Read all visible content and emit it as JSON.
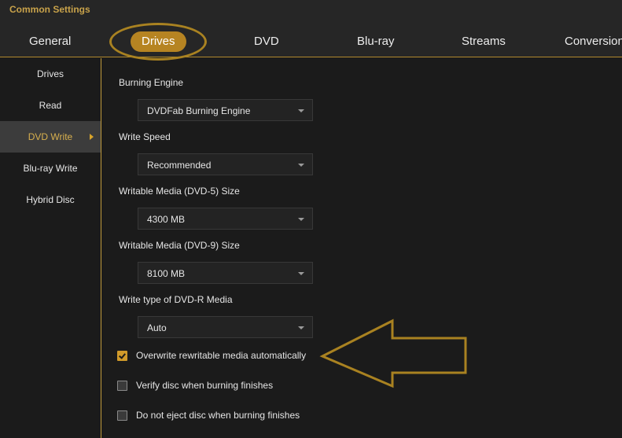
{
  "window": {
    "title": "Common Settings"
  },
  "tabs": [
    {
      "label": "General"
    },
    {
      "label": "Drives",
      "active": true
    },
    {
      "label": "DVD"
    },
    {
      "label": "Blu-ray"
    },
    {
      "label": "Streams"
    },
    {
      "label": "Conversion"
    }
  ],
  "sidebar": {
    "items": [
      {
        "label": "Drives"
      },
      {
        "label": "Read"
      },
      {
        "label": "DVD Write",
        "active": true
      },
      {
        "label": "Blu-ray Write"
      },
      {
        "label": "Hybrid Disc"
      }
    ]
  },
  "settings": {
    "burning_engine": {
      "label": "Burning Engine",
      "value": "DVDFab Burning Engine"
    },
    "write_speed": {
      "label": "Write Speed",
      "value": "Recommended"
    },
    "dvd5_size": {
      "label": "Writable Media (DVD-5) Size",
      "value": "4300 MB"
    },
    "dvd9_size": {
      "label": "Writable Media (DVD-9) Size",
      "value": "8100 MB"
    },
    "dvdr_write_type": {
      "label": "Write type of DVD-R Media",
      "value": "Auto"
    }
  },
  "options": [
    {
      "label": "Overwrite rewritable media automatically",
      "checked": true
    },
    {
      "label": "Verify disc when burning finishes",
      "checked": false
    },
    {
      "label": "Do not eject disc when burning finishes",
      "checked": false
    }
  ],
  "colors": {
    "accent": "#b68422",
    "annotation": "#a98221",
    "background": "#1b1b1b",
    "header": "#262626"
  },
  "icons": {
    "select_arrow": "chevron-down-icon",
    "active_item_marker": "caret-right-icon",
    "checked_box": "checkmark-icon",
    "callout": "arrow-left-annotation"
  }
}
